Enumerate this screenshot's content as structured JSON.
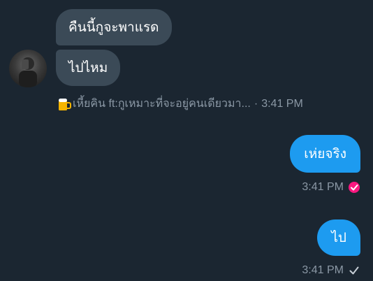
{
  "messages": [
    {
      "text": "คืนนี้กูจะพาแรด"
    },
    {
      "text": "ไปไหม"
    },
    {
      "text": "เห่ยจริง"
    },
    {
      "text": "ไป"
    }
  ],
  "sender": {
    "name": "เหี้ยคิน ft:กูเหมาะที่จะอยู่คนเดียวมา...",
    "time": "3:41 PM",
    "separator": "·"
  },
  "outgoing_meta": [
    {
      "time": "3:41 PM",
      "status": "seen-check-icon"
    },
    {
      "time": "3:41 PM",
      "status": "sent-check-icon"
    }
  ],
  "colors": {
    "background": "#1b2631",
    "incoming_bubble": "#3b4a57",
    "outgoing_bubble": "#1d9bf0",
    "meta_text": "#8b98a5",
    "seen_check": "#f91880"
  },
  "icons": {
    "sender_badge": "beer-mug-icon"
  }
}
